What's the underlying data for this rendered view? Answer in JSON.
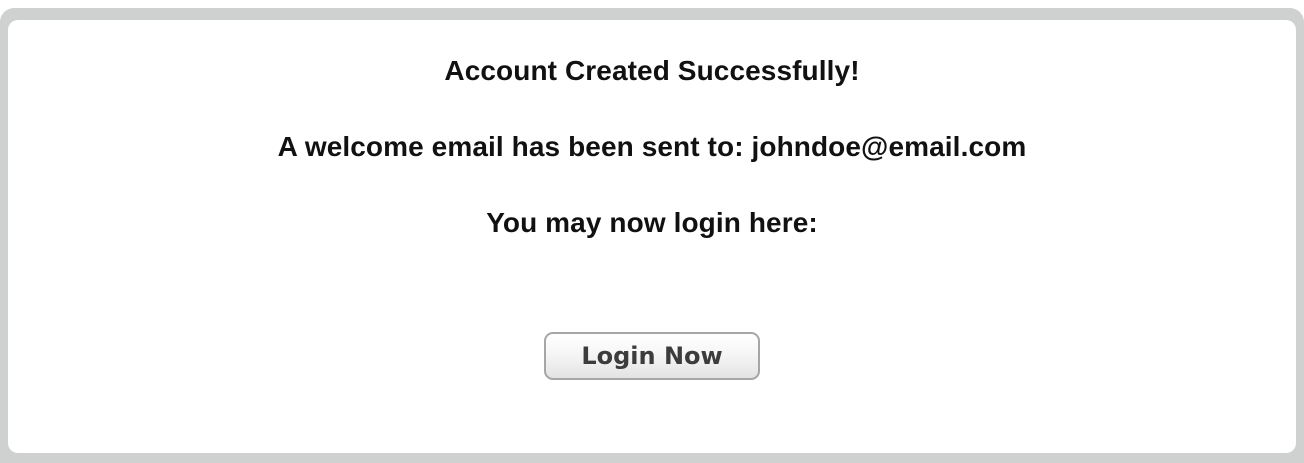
{
  "confirmation": {
    "title": "Account Created Successfully!",
    "email_message": "A welcome email has been sent to: johndoe@email.com",
    "login_prompt": "You may now login here:",
    "login_button_label": "Login Now"
  }
}
